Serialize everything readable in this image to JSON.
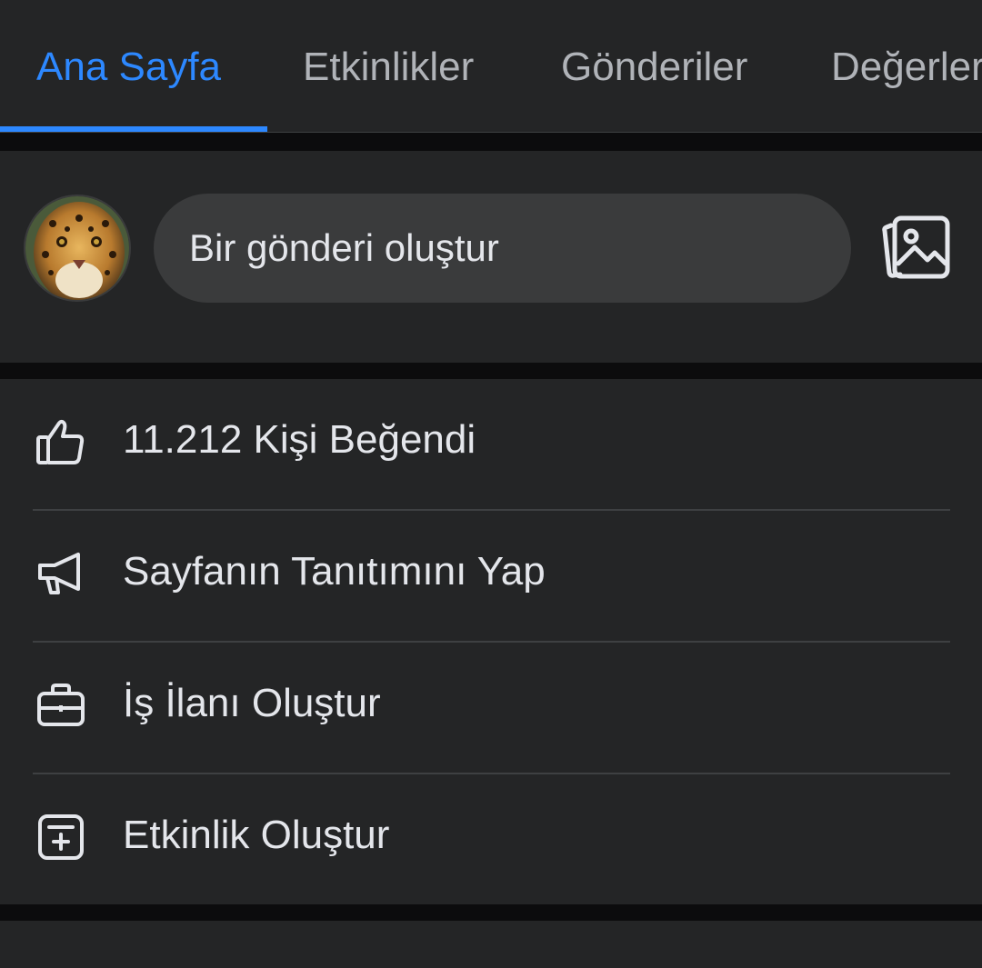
{
  "tabs": [
    {
      "label": "Ana Sayfa",
      "active": true
    },
    {
      "label": "Etkinlikler",
      "active": false
    },
    {
      "label": "Gönderiler",
      "active": false
    },
    {
      "label": "Değerler",
      "active": false
    }
  ],
  "composer": {
    "placeholder": "Bir gönderi oluştur",
    "avatar": "jaguar-profile-photo",
    "photo_icon": "photo-icon"
  },
  "actions": [
    {
      "icon": "thumbs-up-icon",
      "label": "11.212 Kişi Beğendi"
    },
    {
      "icon": "megaphone-icon",
      "label": "Sayfanın Tanıtımını Yap"
    },
    {
      "icon": "briefcase-icon",
      "label": "İş İlanı Oluştur"
    },
    {
      "icon": "calendar-plus-icon",
      "label": "Etkinlik Oluştur"
    }
  ],
  "colors": {
    "accent": "#2d88ff",
    "background": "#242526",
    "separator": "#0c0c0d",
    "input": "#3a3b3c",
    "text": "#e4e6eb",
    "muted": "#b0b3b8"
  }
}
